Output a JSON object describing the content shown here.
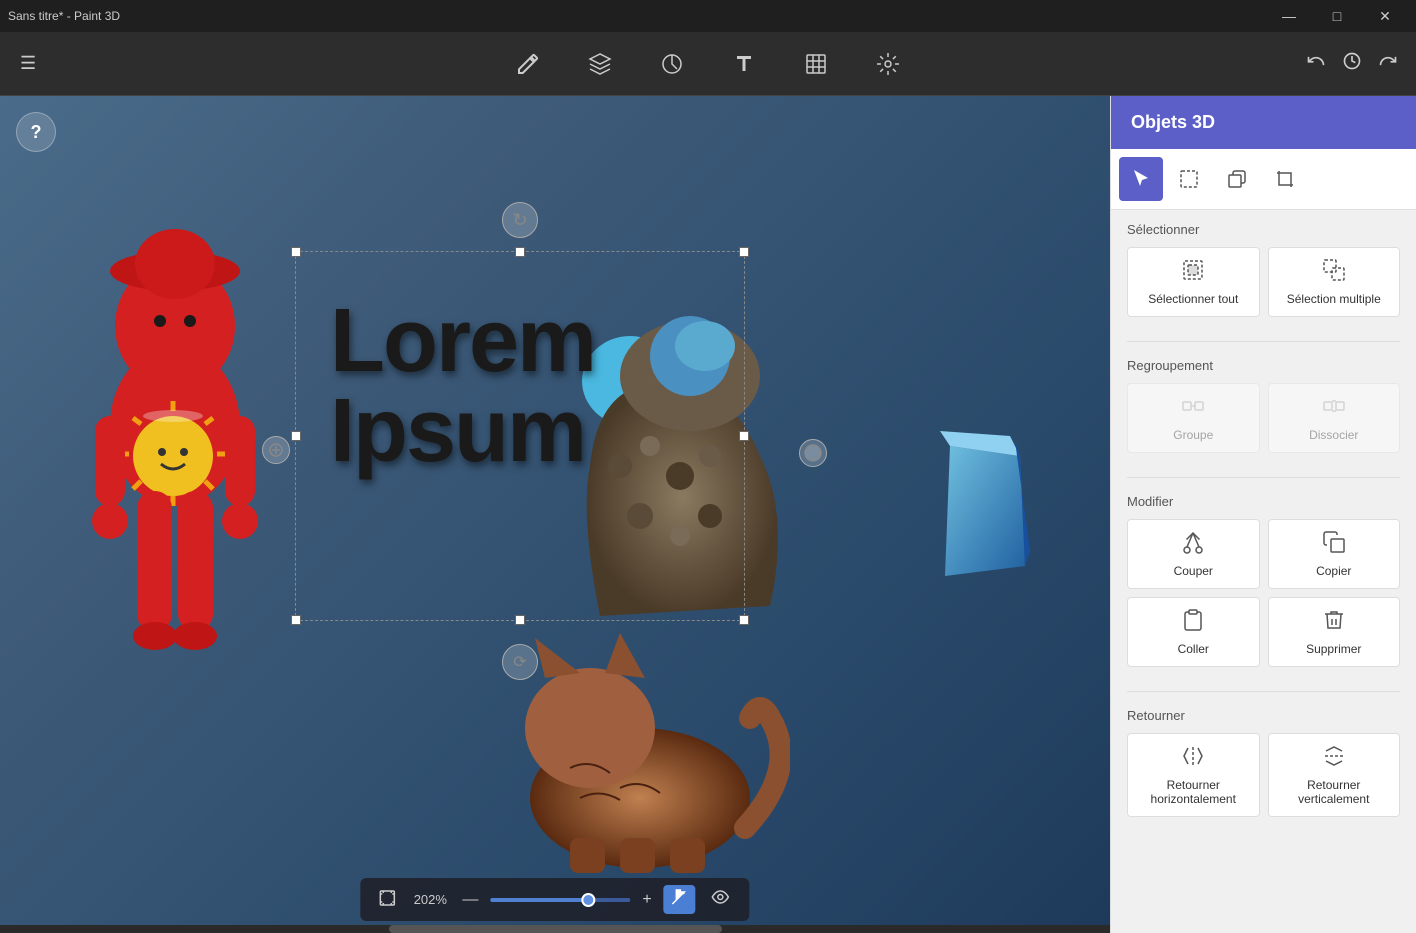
{
  "titlebar": {
    "title": "Sans titre* - Paint 3D",
    "controls": {
      "minimize": "—",
      "maximize": "□",
      "close": "✕"
    }
  },
  "toolbar": {
    "menu_icon": "☰",
    "tools": [
      {
        "name": "brush",
        "icon": "✏",
        "label": "Pinceaux"
      },
      {
        "name": "3d-shapes",
        "icon": "⬡",
        "label": "Formes 3D"
      },
      {
        "name": "stickers",
        "icon": "◎",
        "label": "Autocollants"
      },
      {
        "name": "text",
        "icon": "T",
        "label": "Texte"
      },
      {
        "name": "canvas",
        "icon": "⊡",
        "label": "Zone de dessin"
      },
      {
        "name": "effects",
        "icon": "✦",
        "label": "Effets"
      }
    ],
    "undo": "↩",
    "history": "⏱",
    "redo": "↪"
  },
  "canvas": {
    "help_label": "?",
    "zoom_value": "202%",
    "zoom_minus": "—",
    "zoom_plus": "+"
  },
  "right_panel": {
    "title": "Objets 3D",
    "tools": [
      {
        "name": "select",
        "icon": "↖",
        "label": "Sélectionner",
        "active": true
      },
      {
        "name": "select-box",
        "icon": "⊡",
        "label": "Sélection zone",
        "active": false
      },
      {
        "name": "copy-stamp",
        "icon": "⧉",
        "label": "Copier",
        "active": false
      },
      {
        "name": "crop",
        "icon": "⊠",
        "label": "Recadrer",
        "active": false
      }
    ],
    "sections": {
      "selectionner": {
        "title": "Sélectionner",
        "buttons": [
          {
            "name": "select-all",
            "label": "Sélectionner tout",
            "icon": "⊡"
          },
          {
            "name": "multi-select",
            "label": "Sélection multiple",
            "icon": "⊞"
          }
        ]
      },
      "regroupement": {
        "title": "Regroupement",
        "buttons": [
          {
            "name": "group",
            "label": "Groupe",
            "icon": "⊞",
            "disabled": true
          },
          {
            "name": "ungroup",
            "label": "Dissocier",
            "icon": "⧉",
            "disabled": true
          }
        ]
      },
      "modifier": {
        "title": "Modifier",
        "buttons_row1": [
          {
            "name": "cut",
            "label": "Couper",
            "icon": "✂"
          },
          {
            "name": "copy",
            "label": "Copier",
            "icon": "⧉"
          }
        ],
        "buttons_row2": [
          {
            "name": "paste",
            "label": "Coller",
            "icon": "📋"
          },
          {
            "name": "delete",
            "label": "Supprimer",
            "icon": "🗑"
          }
        ]
      },
      "retourner": {
        "title": "Retourner",
        "buttons": [
          {
            "name": "flip-h",
            "label": "Retourner horizontalement",
            "icon": "↔"
          },
          {
            "name": "flip-v",
            "label": "Retourner verticalement",
            "icon": "↕"
          }
        ]
      }
    }
  }
}
